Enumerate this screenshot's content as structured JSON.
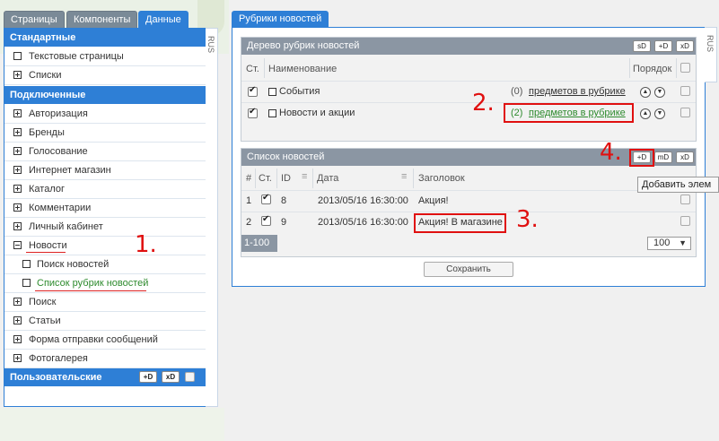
{
  "left": {
    "tabs": [
      "Страницы",
      "Компоненты",
      "Данные"
    ],
    "side_label": "RUS",
    "sections": {
      "standard": "Стандартные",
      "connected": "Подключенные",
      "custom": "Пользовательские"
    },
    "standard_items": [
      "Текстовые страницы",
      "Списки"
    ],
    "connected_items": [
      "Авторизация",
      "Бренды",
      "Голосование",
      "Интернет магазин",
      "Каталог",
      "Комментарии",
      "Личный кабинет",
      "Новости"
    ],
    "news_children": [
      "Поиск новостей",
      "Список рубрик новостей"
    ],
    "more_items": [
      "Поиск",
      "Статьи",
      "Форма отправки сообщений",
      "Фотогалерея"
    ],
    "custom_buttons": {
      "add": "+D",
      "delete": "xD"
    }
  },
  "right": {
    "tab": "Рубрики новостей",
    "side_label": "RUS",
    "tree": {
      "title": "Дерево рубрик новостей",
      "buttons": [
        "sD",
        "+D",
        "xD"
      ],
      "col_status": "Ст.",
      "col_name": "Наименование",
      "col_order": "Порядок",
      "rows": [
        {
          "name": "События",
          "count": "(0)",
          "link": "предметов в рубрике"
        },
        {
          "name": "Новости и акции",
          "count": "(2)",
          "link": "предметов в рубрике"
        }
      ]
    },
    "list": {
      "title": "Список новостей",
      "buttons": [
        "+D",
        "mD",
        "xD"
      ],
      "tooltip": "Добавить элем",
      "cols": {
        "num": "#",
        "status": "Ст.",
        "id": "ID",
        "date": "Дата",
        "title": "Заголовок"
      },
      "rows": [
        {
          "num": "1",
          "id": "8",
          "date": "2013/05/16 16:30:00",
          "title": "Акция!"
        },
        {
          "num": "2",
          "id": "9",
          "date": "2013/05/16 16:30:00",
          "title": "Акция! В магазине"
        }
      ],
      "range": "1-100",
      "per_page": "100"
    },
    "save": "Сохранить"
  },
  "annotations": [
    "1.",
    "2.",
    "3.",
    "4."
  ],
  "colors": {
    "accent": "#2e7fd6",
    "panel_head": "#8b96a3",
    "annotation": "#e01010",
    "active_link": "#2e8b2e"
  }
}
